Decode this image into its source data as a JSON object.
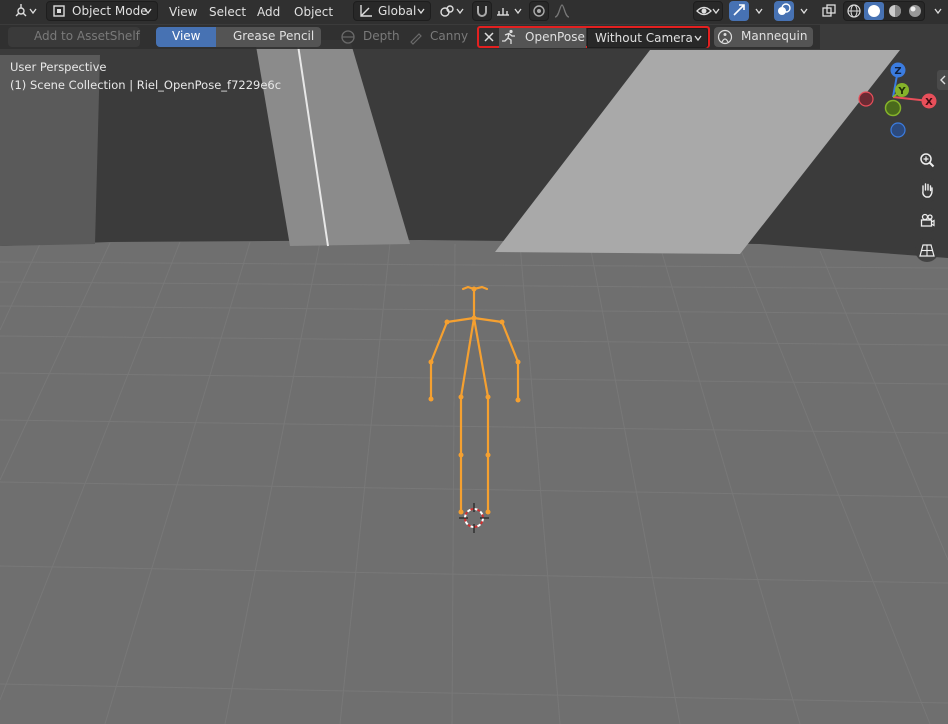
{
  "header": {
    "mode": "Object Mode",
    "menus": [
      "View",
      "Select",
      "Add",
      "Object"
    ],
    "orientation": "Global"
  },
  "toolbar": {
    "add_to_assetshelf": "Add to AssetShelf",
    "view": "View",
    "grease_pencil": "Grease Pencil",
    "depth": "Depth",
    "canny": "Canny",
    "openpose": "OpenPose",
    "camera_mode": "Without Camera",
    "mannequin": "Mannequin"
  },
  "viewport": {
    "perspective": "User Perspective",
    "collection": "(1) Scene Collection | Riel_OpenPose_f7229e6c"
  },
  "gizmo": {
    "z": "Z",
    "y": "Y",
    "x": "X"
  },
  "colors": {
    "accent": "#4772b3",
    "skeleton": "#f5a030",
    "highlight": "#e32020",
    "axis_x": "#e84f5a",
    "axis_y": "#85b32a",
    "axis_z": "#3b7ce0"
  }
}
